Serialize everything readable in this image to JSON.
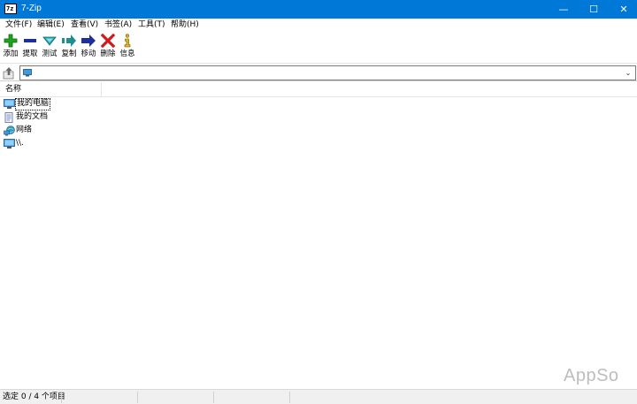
{
  "window": {
    "title": "7-Zip",
    "app_icon_text": "7z",
    "controls": {
      "minimize": "—",
      "maximize": "☐",
      "close": "✕"
    }
  },
  "menu": {
    "items": [
      {
        "label": "文件(F)"
      },
      {
        "label": "编辑(E)"
      },
      {
        "label": "查看(V)"
      },
      {
        "label": "书签(A)"
      },
      {
        "label": "工具(T)"
      },
      {
        "label": "帮助(H)"
      }
    ]
  },
  "toolbar": {
    "buttons": [
      {
        "label": "添加",
        "icon": "plus-icon",
        "color": "#1fa31f"
      },
      {
        "label": "提取",
        "icon": "minus-icon",
        "color": "#1d2f9e"
      },
      {
        "label": "测试",
        "icon": "check-icon",
        "color": "#27a7b3"
      },
      {
        "label": "复制",
        "icon": "copy-arrow-icon",
        "color": "#1c8f8f"
      },
      {
        "label": "移动",
        "icon": "move-arrow-icon",
        "color": "#1d2f9e"
      },
      {
        "label": "删除",
        "icon": "delete-x-icon",
        "color": "#d21a1a"
      },
      {
        "label": "信息",
        "icon": "info-icon",
        "color": "#e0b81a"
      }
    ]
  },
  "address": {
    "value": "",
    "icon": "computer-icon"
  },
  "list": {
    "columns": [
      {
        "label": "名称"
      }
    ],
    "items": [
      {
        "name": "我的电脑",
        "icon": "computer-icon",
        "selected": true
      },
      {
        "name": "我的文档",
        "icon": "document-icon",
        "selected": false
      },
      {
        "name": "网络",
        "icon": "network-icon",
        "selected": false
      },
      {
        "name": "\\\\.",
        "icon": "computer-icon",
        "selected": false
      }
    ]
  },
  "watermark": "AppSo",
  "status": {
    "text": "选定 0 / 4 个项目"
  },
  "colors": {
    "titlebar": "#0078d7",
    "window_bg": "#ffffff",
    "statusbar_bg": "#f0f0f0"
  }
}
